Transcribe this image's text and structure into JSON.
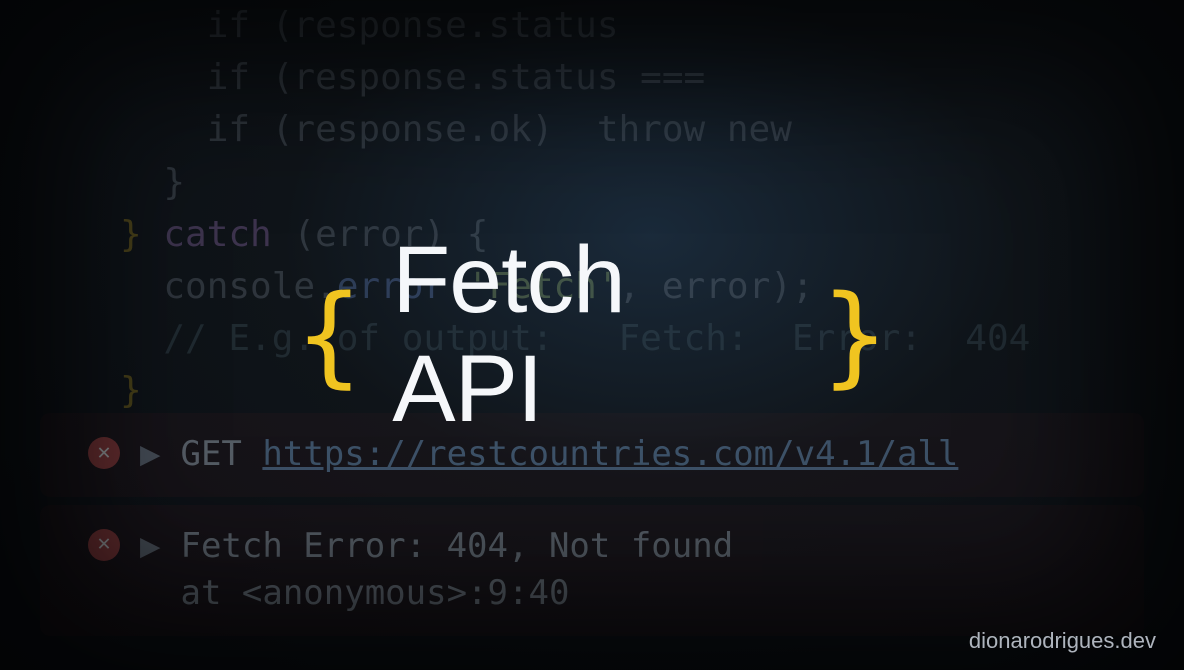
{
  "code": {
    "l1": "    if (response.status",
    "l2": "    if (response.status ===",
    "l3": "    if (response.ok)  throw new",
    "l4": "  }",
    "l5a": "} ",
    "l5b": "catch",
    "l5c": " (error) {",
    "l6a": "  console.",
    "l6b": "error",
    "l6c": "(",
    "l6d": "'Fetch'",
    "l6e": ", error);",
    "l7": "  // E.g. of output:   Fetch:  Error:  404",
    "l8": "}"
  },
  "console": {
    "row1": {
      "method": "GET",
      "url": "https://restcountries.com/v4.1/all"
    },
    "row2": {
      "line1": "Fetch Error: 404, Not found",
      "line2": "  at <anonymous>:9:40"
    }
  },
  "hero": {
    "left_brace": "{",
    "title": "Fetch API",
    "right_brace": "}"
  },
  "watermark": "dionarodrigues.dev"
}
